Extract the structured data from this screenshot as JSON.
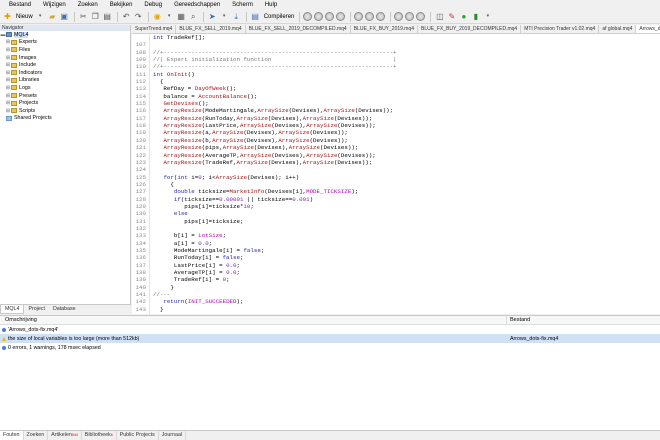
{
  "menu": [
    "Bestand",
    "Wijzigen",
    "Zoeken",
    "Bekijken",
    "Debug",
    "Gereedschappen",
    "Scherm",
    "Hulp"
  ],
  "toolbar": {
    "new_label": "Nieuw",
    "compile_label": "Compileren"
  },
  "navigator": {
    "title": "Navigator",
    "root": "MQL4",
    "items": [
      "Experts",
      "Files",
      "Images",
      "Include",
      "Indicators",
      "Libraries",
      "Logs",
      "Presets",
      "Projects",
      "Scripts"
    ],
    "shared": "Shared Projects",
    "tabs": [
      "MQL4",
      "Project",
      "Database"
    ]
  },
  "editor": {
    "tabs": [
      "SuperTrend.mq4",
      "BLUE_FX_SELL_2019.mq4",
      "BLUE_FX_SELL_2019_DECOMPILED.mq4",
      "BLUE_FX_BUY_2019.mq4",
      "BLUE_FX_BUY_2019_DECOMPILED.mq4",
      "MTI Precision Trader v1.02.mq4",
      "af global.mq4",
      "Arrows_dots-fix.mq4"
    ],
    "lines": [
      {
        "n": "",
        "t": "int TradeRef[];"
      },
      {
        "n": "107",
        "t": ""
      },
      {
        "n": "108",
        "t": "//+------------------------------------------------------------------+"
      },
      {
        "n": "109",
        "t": "//| Expert initialization function                                   |"
      },
      {
        "n": "110",
        "t": "//+------------------------------------------------------------------+"
      },
      {
        "n": "111",
        "t": "int OnInit()"
      },
      {
        "n": "112",
        "t": "  {"
      },
      {
        "n": "113",
        "t": "   RefDay = DayOfWeek();"
      },
      {
        "n": "114",
        "t": "   balance = AccountBalance();"
      },
      {
        "n": "115",
        "t": "   GetDevises();"
      },
      {
        "n": "116",
        "t": "   ArrayResize(ModeMartingale,ArraySize(Devises),ArraySize(Devises));"
      },
      {
        "n": "117",
        "t": "   ArrayResize(RunToday,ArraySize(Devises),ArraySize(Devises));"
      },
      {
        "n": "118",
        "t": "   ArrayResize(LastPrice,ArraySize(Devises),ArraySize(Devises));"
      },
      {
        "n": "119",
        "t": "   ArrayResize(a,ArraySize(Devises),ArraySize(Devises));"
      },
      {
        "n": "120",
        "t": "   ArrayResize(b,ArraySize(Devises),ArraySize(Devises));"
      },
      {
        "n": "121",
        "t": "   ArrayResize(pips,ArraySize(Devises),ArraySize(Devises));"
      },
      {
        "n": "122",
        "t": "   ArrayResize(AverageTP,ArraySize(Devises),ArraySize(Devises));"
      },
      {
        "n": "123",
        "t": "   ArrayResize(TradeRef,ArraySize(Devises),ArraySize(Devises));"
      },
      {
        "n": "124",
        "t": ""
      },
      {
        "n": "125",
        "t": "   for(int i=0; i<ArraySize(Devises); i++)"
      },
      {
        "n": "126",
        "t": "     {"
      },
      {
        "n": "127",
        "t": "      double ticksize=MarketInfo(Devises[i],MODE_TICKSIZE);"
      },
      {
        "n": "128",
        "t": "      if(ticksize==0.00001 || ticksize==0.001)"
      },
      {
        "n": "129",
        "t": "         pips[i]=ticksize*10;"
      },
      {
        "n": "130",
        "t": "      else"
      },
      {
        "n": "131",
        "t": "         pips[i]=ticksize;"
      },
      {
        "n": "132",
        "t": ""
      },
      {
        "n": "133",
        "t": "      b[i] = LotSize;"
      },
      {
        "n": "134",
        "t": "      a[i] = 0.0;"
      },
      {
        "n": "135",
        "t": "      ModeMartingale[i] = false;"
      },
      {
        "n": "136",
        "t": "      RunToday[i] = false;"
      },
      {
        "n": "137",
        "t": "      LastPrice[i] = 0.0;"
      },
      {
        "n": "138",
        "t": "      AverageTP[i] = 0.0;"
      },
      {
        "n": "139",
        "t": "      TradeRef[i] = 0;"
      },
      {
        "n": "140",
        "t": "     }"
      },
      {
        "n": "141",
        "t": "//---"
      },
      {
        "n": "142",
        "t": "   return(INIT_SUCCEEDED);"
      },
      {
        "n": "143",
        "t": "  }"
      }
    ]
  },
  "output": {
    "col_desc": "Omschrijving",
    "col_file": "Bestand",
    "rows": [
      {
        "icon": "info",
        "desc": "'Arrows_dots-fix.mq4'",
        "file": ""
      },
      {
        "icon": "warning",
        "desc": "the size of local variables is too large (more than 512kb)",
        "file": "Arrows_dots-fix.mq4"
      },
      {
        "icon": "info",
        "desc": "0 errors, 1 warnings, 178 msec elapsed",
        "file": ""
      }
    ],
    "tabs": [
      "Fouten",
      "Zoeken",
      "Artikelen",
      "Bibliotheek",
      "Public Projects",
      "Journaal"
    ],
    "tab_badges": {
      "Artikelen": "944",
      "Bibliotheek": "6"
    }
  }
}
